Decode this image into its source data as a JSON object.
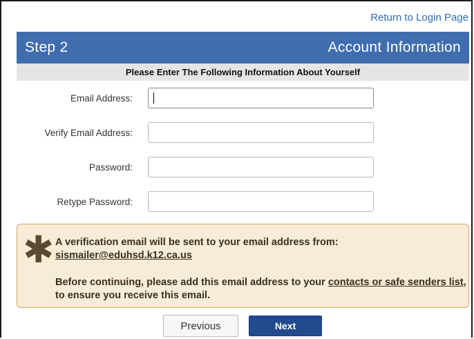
{
  "top_link": "Return to Login Page",
  "header": {
    "step": "Step 2",
    "title": "Account Information"
  },
  "subheader": "Please Enter The Following Information About Yourself",
  "form": {
    "email_label": "Email Address:",
    "email_value": "",
    "verify_email_label": "Verify Email Address:",
    "verify_email_value": "",
    "password_label": "Password:",
    "password_value": "",
    "retype_password_label": "Retype Password:",
    "retype_password_value": ""
  },
  "notice": {
    "icon": "asterisk-icon",
    "line1": "A verification email will be sent to your email address from:",
    "sender_email": "sismailer@eduhsd.k12.ca.us",
    "line2_pre": "Before continuing, please add this email address to your ",
    "line2_link": "contacts or safe senders list",
    "line2_post": ", to ensure you receive this email."
  },
  "buttons": {
    "previous": "Previous",
    "next": "Next"
  },
  "colors": {
    "header_bg": "#3f6db0",
    "link": "#2b6cb0",
    "notice_bg": "#f8ecd6",
    "notice_border": "#c9a66b",
    "next_bg": "#224a8f"
  }
}
